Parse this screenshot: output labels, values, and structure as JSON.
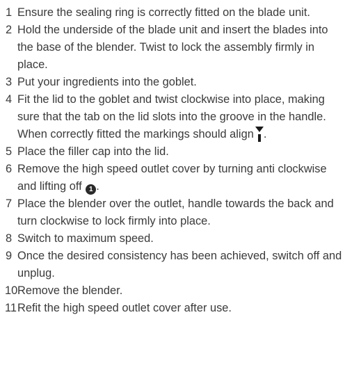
{
  "steps": [
    {
      "number": "1",
      "text": "Ensure the sealing ring is correctly fitted on the blade unit."
    },
    {
      "number": "2",
      "text": "Hold the underside of the blade unit and insert the blades into the base of the blender. Twist to lock the assembly firmly in place."
    },
    {
      "number": "3",
      "text": "Put your ingredients into the goblet."
    },
    {
      "number": "4",
      "text": "Fit the lid to the goblet and twist clockwise into place, making sure that the tab on the lid slots into the groove in the handle. When correctly fitted the markings should align",
      "after_icon": "."
    },
    {
      "number": "5",
      "text": "Place the filler cap into the lid."
    },
    {
      "number": "6",
      "text": "Remove the high speed outlet cover by turning anti clockwise and lifting off",
      "icon_label": "1",
      "after_icon": "."
    },
    {
      "number": "7",
      "text": "Place the blender over the outlet, handle towards the back and turn clockwise to lock firmly into place."
    },
    {
      "number": "8",
      "text": "Switch to maximum speed."
    },
    {
      "number": "9",
      "text": "Once the desired consistency has been achieved, switch off and unplug."
    },
    {
      "number": "10",
      "text": "Remove the blender."
    },
    {
      "number": "11",
      "text": "Refit the high speed outlet cover after use."
    }
  ],
  "icons": {
    "alignment_marker": "alignment-marker-icon",
    "circled_number": "circled-number-icon"
  }
}
